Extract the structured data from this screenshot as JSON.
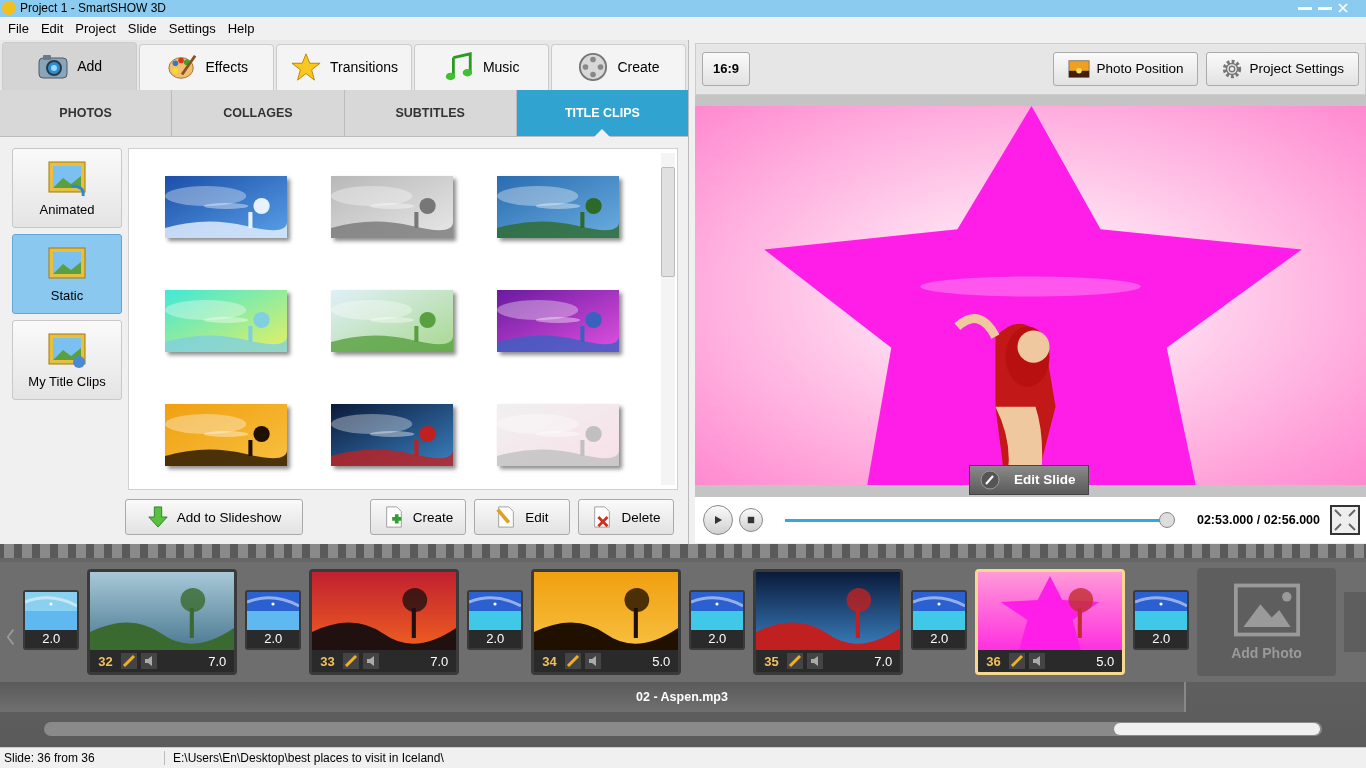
{
  "window": {
    "title": "Project 1 - SmartSHOW 3D"
  },
  "menu": [
    "File",
    "Edit",
    "Project",
    "Slide",
    "Settings",
    "Help"
  ],
  "main_tabs": [
    {
      "label": "Add",
      "selected": true
    },
    {
      "label": "Effects",
      "selected": false
    },
    {
      "label": "Transitions",
      "selected": false
    },
    {
      "label": "Music",
      "selected": false
    },
    {
      "label": "Create",
      "selected": false
    }
  ],
  "sub_tabs": [
    {
      "label": "PHOTOS",
      "selected": false
    },
    {
      "label": "COLLAGES",
      "selected": false
    },
    {
      "label": "SUBTITLES",
      "selected": false
    },
    {
      "label": "TITLE CLIPS",
      "selected": true
    }
  ],
  "categories": [
    {
      "label": "Animated",
      "selected": false
    },
    {
      "label": "Static",
      "selected": true
    },
    {
      "label": "My Title Clips",
      "selected": false
    }
  ],
  "templates": [
    {
      "kind": "picture"
    },
    {
      "kind": "picture"
    },
    {
      "kind": "picture"
    },
    {
      "kind": "picture"
    },
    {
      "kind": "picture"
    },
    {
      "kind": "picture"
    },
    {
      "kind": "picture"
    },
    {
      "kind": "picture"
    },
    {
      "kind": "picture"
    }
  ],
  "library_buttons": [
    "Add to Slideshow",
    "Create",
    "Edit",
    "Delete"
  ],
  "aspect_button": "16:9",
  "toolbar_buttons": [
    "Photo Position",
    "Project Settings"
  ],
  "edit_slide_button": "Edit Slide",
  "player": {
    "level": 0.98,
    "time": "02:53.000 / 02:56.000"
  },
  "timeline": [
    {
      "kind": "transition",
      "duration": "2.0"
    },
    {
      "kind": "slide",
      "number": "32",
      "duration": "7.0",
      "selected": false
    },
    {
      "kind": "transition",
      "duration": "2.0"
    },
    {
      "kind": "slide",
      "number": "33",
      "duration": "7.0",
      "selected": false
    },
    {
      "kind": "transition",
      "duration": "2.0"
    },
    {
      "kind": "slide",
      "number": "34",
      "duration": "5.0",
      "selected": false
    },
    {
      "kind": "transition",
      "duration": "2.0"
    },
    {
      "kind": "slide",
      "number": "35",
      "duration": "7.0",
      "selected": false
    },
    {
      "kind": "transition",
      "duration": "2.0"
    },
    {
      "kind": "slide",
      "number": "36",
      "duration": "5.0",
      "selected": true
    },
    {
      "kind": "transition",
      "duration": "2.0"
    }
  ],
  "add_photo": "Add Photo",
  "audio_track": "02 - Aspen.mp3",
  "status_bar": [
    "Slide: 36 from 36",
    "E:\\Users\\En\\Desktop\\best places to visit in Iceland\\"
  ]
}
